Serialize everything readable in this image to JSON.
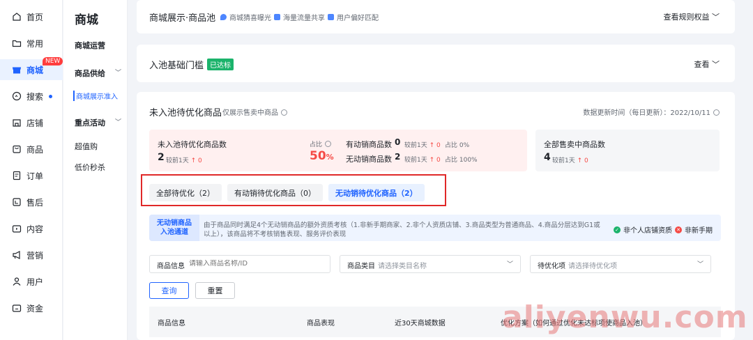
{
  "nav": {
    "items": [
      {
        "label": "首页",
        "icon": "home-icon"
      },
      {
        "label": "常用",
        "icon": "folder-icon"
      },
      {
        "label": "商城",
        "icon": "shop-icon",
        "badge": "NEW"
      },
      {
        "label": "搜索",
        "icon": "search-icon"
      },
      {
        "label": "店铺",
        "icon": "store-icon"
      },
      {
        "label": "商品",
        "icon": "bag-icon"
      },
      {
        "label": "订单",
        "icon": "order-icon"
      },
      {
        "label": "售后",
        "icon": "after-sale-icon"
      },
      {
        "label": "内容",
        "icon": "content-icon"
      },
      {
        "label": "营销",
        "icon": "megaphone-icon"
      },
      {
        "label": "用户",
        "icon": "user-icon"
      },
      {
        "label": "资金",
        "icon": "wallet-icon"
      }
    ]
  },
  "menu2": {
    "title": "商城",
    "items": [
      "商城运营",
      "商品供给",
      "商城展示准入",
      "重点活动",
      "超值购",
      "低价秒杀"
    ]
  },
  "card1": {
    "title": "商城展示·商品池",
    "tags": [
      "商城猜喜曝光",
      "海量流量共享",
      "用户偏好匹配"
    ],
    "link": "查看规则权益"
  },
  "card2": {
    "title": "入池基础门槛",
    "badge": "已达标",
    "link": "查看"
  },
  "card3": {
    "title": "未入池待优化商品",
    "subtitle": "仅展示售卖中商品",
    "update_time": "数据更新时间（每日更新）：2022/10/11",
    "pink": {
      "label": "未入池待优化商品数",
      "count": "2",
      "compare": "较前1天",
      "delta": "↑ 0",
      "ratio_label": "占比",
      "ratio": "50",
      "ratio_unit": "%",
      "active_label": "有动销商品数",
      "active_count": "0",
      "active_compare": "较前1天",
      "active_delta": "↑ 0",
      "active_ratio": "占比 0%",
      "inactive_label": "无动销商品数",
      "inactive_count": "2",
      "inactive_compare": "较前1天",
      "inactive_delta": "↑ 0",
      "inactive_ratio": "占比 100%"
    },
    "grey": {
      "label": "全部售卖中商品数",
      "count": "4",
      "compare": "较前1天",
      "delta": "↑ 0"
    },
    "tabs": [
      "全部待优化（2）",
      "有动销待优化商品（0）",
      "无动销待优化商品（2）"
    ],
    "notice": {
      "label_line1": "无动销商品",
      "label_line2": "入池通道",
      "text": "由于商品同时满足4个无动销商品的额外资质考核（1.非新手期商家、2.非个人资质店铺、3.商品类型为普通商品、4.商品分层达到G1或以上），该商品将不考核销售表现、服务评价表现",
      "right1": "非个人店铺资质",
      "right2": "非新手期"
    },
    "filters": {
      "f1_label": "商品信息",
      "f1_placeholder": "请输入商品名称/ID",
      "f2_label": "商品类目",
      "f2_placeholder": "请选择类目名称",
      "f3_label": "待优化项",
      "f3_placeholder": "请选择待优化项"
    },
    "buttons": {
      "query": "查询",
      "reset": "重置"
    },
    "table_headers": [
      "商品信息",
      "商品表现",
      "近30天商城数据",
      "优化方案（如何通过优化未达标项使商品入池）"
    ]
  },
  "watermark": "aliyenwu.com",
  "colors": {
    "primary": "#1f63ff",
    "success": "#1bb36b",
    "danger": "#f54a45",
    "highlight_frame": "#e02828"
  }
}
